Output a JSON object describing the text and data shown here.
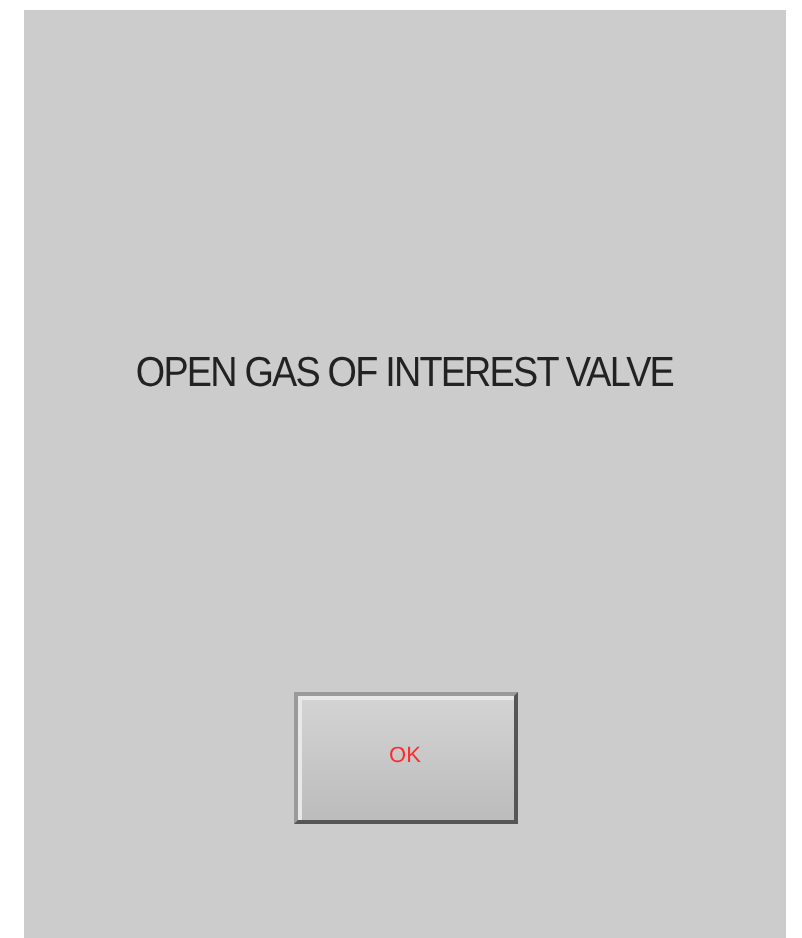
{
  "dialog": {
    "message": "OPEN GAS OF INTEREST VALVE",
    "buttons": [
      {
        "label": "OK"
      }
    ]
  }
}
